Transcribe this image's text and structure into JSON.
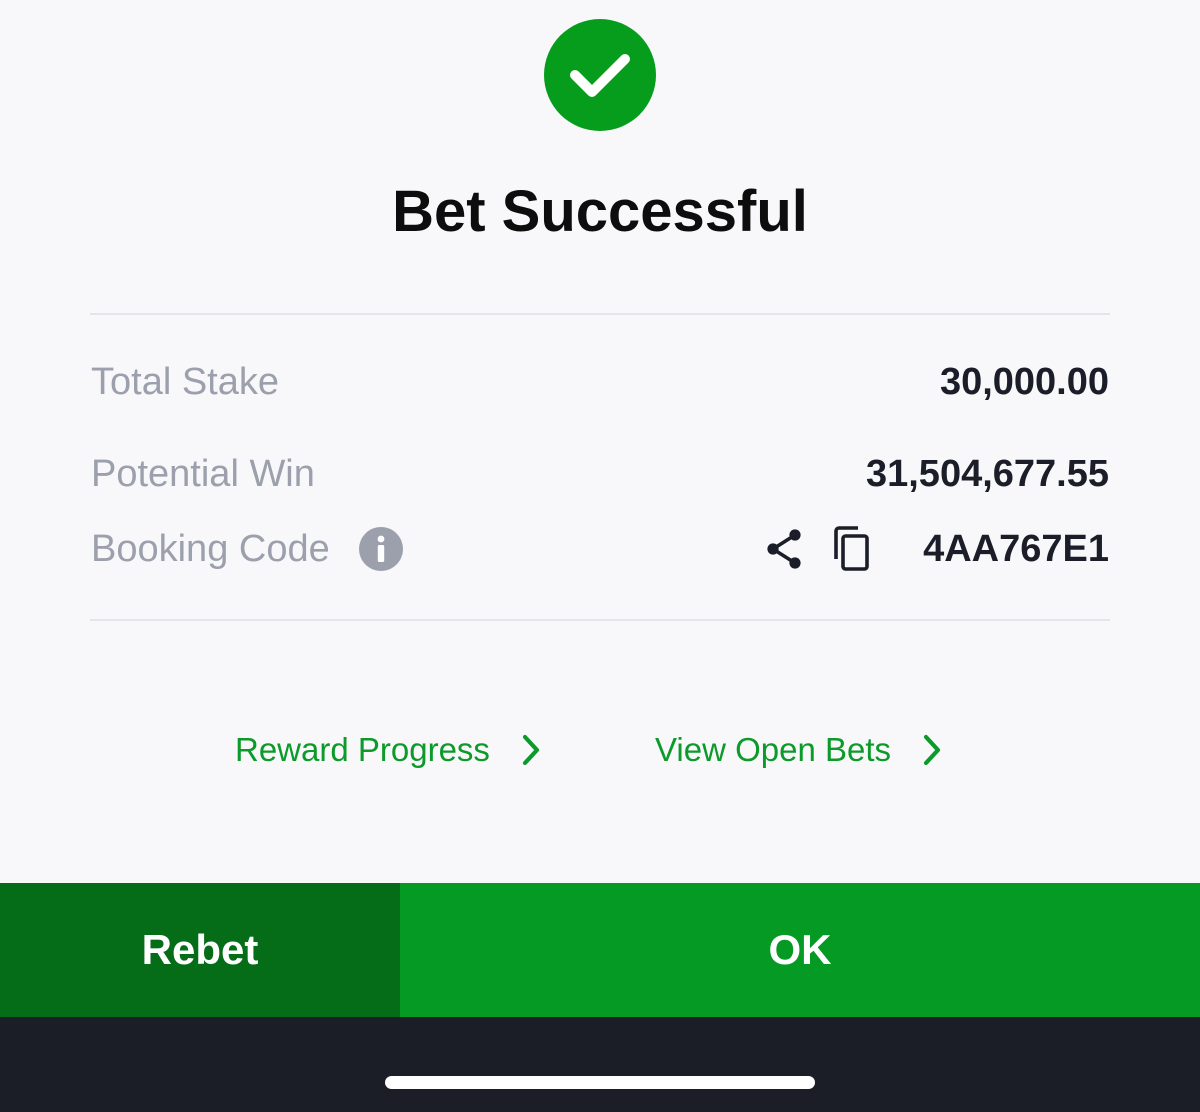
{
  "header": {
    "icon": "check-circle-icon",
    "title": "Bet Successful"
  },
  "details": {
    "total_stake": {
      "label": "Total Stake",
      "value": "30,000.00"
    },
    "potential_win": {
      "label": "Potential Win",
      "value": "31,504,677.55"
    },
    "booking_code": {
      "label": "Booking Code",
      "info_icon": "info-icon",
      "share_icon": "share-icon",
      "copy_icon": "copy-icon",
      "value": "4AA767E1"
    }
  },
  "links": {
    "reward_progress": "Reward Progress",
    "view_open_bets": "View Open Bets"
  },
  "actions": {
    "rebet_label": "Rebet",
    "ok_label": "OK"
  },
  "colors": {
    "success_green": "#079d1c",
    "link_green": "#0c9a2a",
    "rebet_bg": "#056d17",
    "ok_bg": "#049a23",
    "label_gray": "#9ca0ac",
    "value_dark": "#1b1e28"
  }
}
